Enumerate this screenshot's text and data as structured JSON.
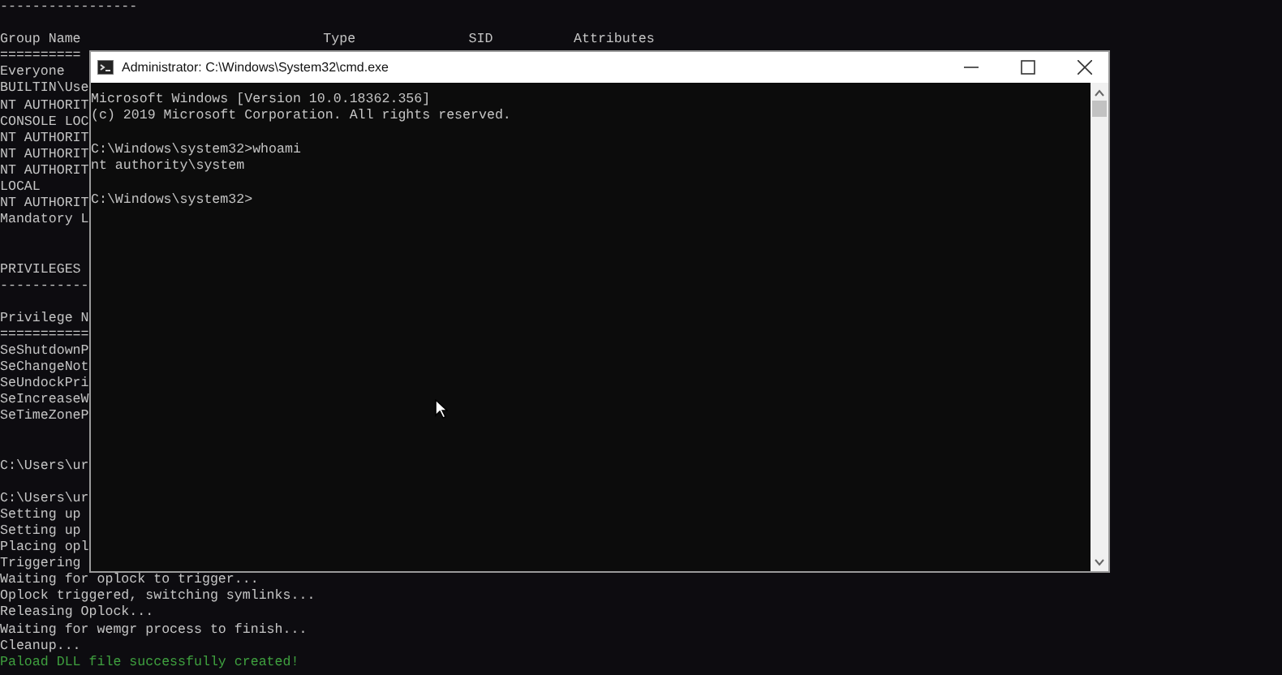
{
  "background_console": {
    "lines": [
      {
        "text": "-----------------",
        "kind": "output"
      },
      {
        "kind": "blank"
      },
      {
        "text": "Group Name                              Type              SID          Attributes",
        "kind": "output"
      },
      {
        "text": "==========",
        "kind": "output"
      },
      {
        "text": "Everyone",
        "kind": "output"
      },
      {
        "text": "BUILTIN\\Use",
        "kind": "output"
      },
      {
        "text": "NT AUTHORIT",
        "kind": "output"
      },
      {
        "text": "CONSOLE LOC",
        "kind": "output"
      },
      {
        "text": "NT AUTHORIT",
        "kind": "output"
      },
      {
        "text": "NT AUTHORIT",
        "kind": "output"
      },
      {
        "text": "NT AUTHORIT",
        "kind": "output"
      },
      {
        "text": "LOCAL",
        "kind": "output"
      },
      {
        "text": "NT AUTHORIT",
        "kind": "output"
      },
      {
        "text": "Mandatory L",
        "kind": "output"
      },
      {
        "kind": "blank"
      },
      {
        "kind": "blank"
      },
      {
        "text": "PRIVILEGES",
        "kind": "output"
      },
      {
        "text": "-----------",
        "kind": "output"
      },
      {
        "kind": "blank"
      },
      {
        "text": "Privilege N",
        "kind": "output"
      },
      {
        "text": "===========",
        "kind": "output"
      },
      {
        "text": "SeShutdownP",
        "kind": "output"
      },
      {
        "text": "SeChangeNot",
        "kind": "output"
      },
      {
        "text": "SeUndockPri",
        "kind": "output"
      },
      {
        "text": "SeIncreaseW",
        "kind": "output"
      },
      {
        "text": "SeTimeZoneP",
        "kind": "output"
      },
      {
        "kind": "blank"
      },
      {
        "kind": "blank"
      },
      {
        "text": "C:\\Users\\ur",
        "kind": "output"
      },
      {
        "kind": "blank"
      },
      {
        "text": "C:\\Users\\ur",
        "kind": "output"
      },
      {
        "text": "Setting up",
        "kind": "output"
      },
      {
        "text": "Setting up",
        "kind": "output"
      },
      {
        "text": "Placing opl",
        "kind": "output"
      },
      {
        "text": "Triggering",
        "kind": "output"
      },
      {
        "text": "Waiting for oplock to trigger...",
        "kind": "output"
      },
      {
        "text": "Oplock triggered, switching symlinks...",
        "kind": "output"
      },
      {
        "text": "Releasing Oplock...",
        "kind": "output"
      },
      {
        "text": "Waiting for wemgr process to finish...",
        "kind": "output"
      },
      {
        "text": "Cleanup...",
        "kind": "output"
      },
      {
        "text": "Paload DLL file successfully created!",
        "kind": "success"
      }
    ]
  },
  "window": {
    "title": "Administrator: C:\\Windows\\System32\\cmd.exe",
    "lines": [
      {
        "text": "Microsoft Windows [Version 10.0.18362.356]",
        "kind": "output"
      },
      {
        "text": "(c) 2019 Microsoft Corporation. All rights reserved.",
        "kind": "output"
      },
      {
        "kind": "blank"
      },
      {
        "text": "C:\\Windows\\system32>whoami",
        "kind": "output"
      },
      {
        "text": "nt authority\\system",
        "kind": "output"
      },
      {
        "kind": "blank"
      },
      {
        "text": "C:\\Windows\\system32>",
        "kind": "output"
      }
    ]
  }
}
